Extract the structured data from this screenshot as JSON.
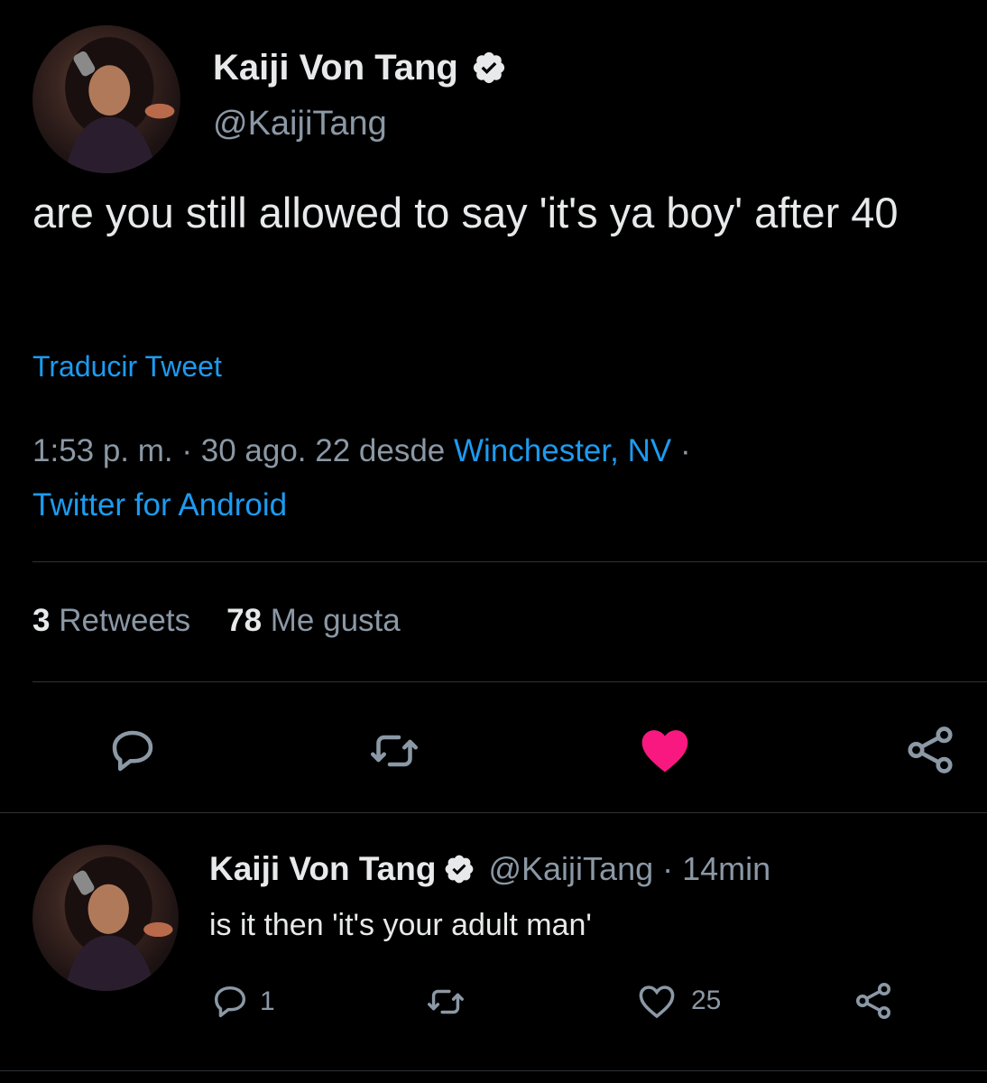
{
  "tweet": {
    "display_name": "Kaiji Von Tang",
    "handle": "@KaijiTang",
    "text": "are you still allowed to say 'it's ya boy' after 40",
    "translate_label": "Traducir Tweet",
    "time": "1:53 p. m. · 30 ago. 22 desde",
    "location": "Winchester, NV",
    "separator": "·",
    "source": "Twitter for Android",
    "retweets_count": "3",
    "retweets_label": "Retweets",
    "likes_count": "78",
    "likes_label": "Me gusta",
    "liked": true
  },
  "actions": {
    "reply_icon": "reply-icon",
    "retweet_icon": "retweet-icon",
    "like_icon": "heart-filled-icon",
    "share_icon": "share-icon"
  },
  "reply": {
    "display_name": "Kaiji Von Tang",
    "handle_time": "@KaijiTang · 14min",
    "text": "is it then 'it's your adult man'",
    "reply_count": "1",
    "like_count": "25"
  },
  "colors": {
    "background": "#000000",
    "text": "#e7e9ea",
    "secondary": "#8b98a5",
    "link": "#1d9bf0",
    "like": "#f91880",
    "divider": "#2f3336"
  }
}
